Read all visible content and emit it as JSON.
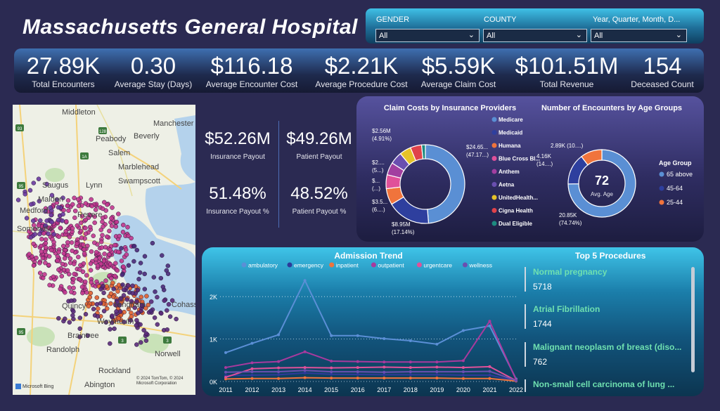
{
  "header": {
    "title": "Massachusetts General Hospital"
  },
  "filters": [
    {
      "label": "GENDER",
      "value": "All"
    },
    {
      "label": "COUNTY",
      "value": "All"
    },
    {
      "label": "Year, Quarter, Month, D...",
      "value": "All"
    }
  ],
  "kpis": [
    {
      "value": "27.89K",
      "label": "Total Encounters"
    },
    {
      "value": "0.30",
      "label": "Average Stay (Days)"
    },
    {
      "value": "$116.18",
      "label": "Average Encounter Cost"
    },
    {
      "value": "$2.21K",
      "label": "Average Procedure Cost"
    },
    {
      "value": "$5.59K",
      "label": "Average Claim Cost"
    },
    {
      "value": "$101.51M",
      "label": "Total Revenue"
    },
    {
      "value": "154",
      "label": "Deceased Count"
    }
  ],
  "map": {
    "places": [
      "Middleton",
      "Manchester",
      "Peabody",
      "Beverly",
      "Salem",
      "Marblehead",
      "Swampscott",
      "Saugus",
      "Lynn",
      "Malden",
      "Medford",
      "Revere",
      "Somerville",
      "Quincy",
      "Hingham",
      "Cohasset",
      "Weymouth",
      "Braintree",
      "Randolph",
      "Norwell",
      "Rockland",
      "Abington"
    ],
    "highway_shields": [
      "93",
      "95",
      "128",
      "1A",
      "3",
      "95",
      "3"
    ],
    "attribution": "© 2024 TomTom, © 2024 Microsoft Corporation",
    "logo": "Microsoft Bing"
  },
  "payout": {
    "insurance_payout": {
      "value": "$52.26M",
      "label": "Insurance Payout"
    },
    "patient_payout": {
      "value": "$49.26M",
      "label": "Patient Payout"
    },
    "insurance_pct": {
      "value": "51.48%",
      "label": "Insurance Payout %"
    },
    "patient_pct": {
      "value": "48.52%",
      "label": "Patient Payout %"
    }
  },
  "chart_data": [
    {
      "type": "pie",
      "title": "Claim Costs by Insurance Providers",
      "legend_position": "right",
      "categories": [
        "Medicare",
        "Medicaid",
        "Humana",
        "Blue Cross Bl...",
        "Anthem",
        "Aetna",
        "UnitedHealth...",
        "Cigna Health",
        "Dual Eligible"
      ],
      "values": [
        47.17,
        17.14,
        6.5,
        5.5,
        5.0,
        4.91,
        4.6,
        4.5,
        1.5
      ],
      "colors": [
        "#5a8fd4",
        "#2e3f9e",
        "#f0743c",
        "#e0519a",
        "#a23fa0",
        "#6a4fb0",
        "#e6c229",
        "#e0424a",
        "#1d8a80"
      ],
      "data_labels": [
        {
          "slice": "Medicare",
          "line1": "$24.65...",
          "line2": "(47.17...)"
        },
        {
          "slice": "Medicaid",
          "line1": "$8.95M",
          "line2": "(17.14%)"
        },
        {
          "slice": "Humana",
          "line1": "$3.5...",
          "line2": "(6....)"
        },
        {
          "slice": "Blue Cross Bl...",
          "line1": "$...",
          "line2": "(...)"
        },
        {
          "slice": "Anthem",
          "line1": "$2....",
          "line2": "(5...)"
        },
        {
          "slice": "Aetna",
          "line1": "$2.56M",
          "line2": "(4.91%)"
        }
      ]
    },
    {
      "type": "pie",
      "title": "Number of Encounters by Age Groups",
      "legend_title": "Age Group",
      "legend_position": "right",
      "categories": [
        "65 above",
        "45-64",
        "25-44"
      ],
      "values": [
        20.85,
        4.16,
        2.89
      ],
      "percent": [
        74.74,
        14.9,
        10.4
      ],
      "colors": [
        "#5a8fd4",
        "#2e3f9e",
        "#f0743c"
      ],
      "center_value": "72",
      "center_label": "Avg. Age",
      "data_labels": [
        {
          "slice": "65 above",
          "line1": "20.85K",
          "line2": "(74.74%)"
        },
        {
          "slice": "45-64",
          "line1": "4.16K",
          "line2": "(14....)"
        },
        {
          "slice": "25-44",
          "line1": "2.89K (10....)",
          "line2": ""
        }
      ]
    },
    {
      "type": "line",
      "title": "Admission Trend",
      "legend_position": "top",
      "x": [
        2011,
        2012,
        2013,
        2014,
        2015,
        2016,
        2017,
        2018,
        2019,
        2020,
        2021,
        2022
      ],
      "ylim": [
        0,
        2500
      ],
      "yticks": [
        0,
        1000,
        2000
      ],
      "ytick_labels": [
        "0K",
        "1K",
        "2K"
      ],
      "grid": true,
      "series": [
        {
          "name": "ambulatory",
          "color": "#5b8fd6",
          "values": [
            680,
            900,
            1100,
            2380,
            1080,
            1080,
            1010,
            960,
            880,
            1200,
            1310,
            60
          ]
        },
        {
          "name": "emergency",
          "color": "#2d3a9a",
          "values": [
            140,
            150,
            160,
            200,
            170,
            165,
            160,
            160,
            160,
            150,
            150,
            10
          ]
        },
        {
          "name": "inpatient",
          "color": "#f0743c",
          "values": [
            60,
            70,
            70,
            90,
            80,
            80,
            80,
            80,
            80,
            70,
            70,
            10
          ]
        },
        {
          "name": "outpatient",
          "color": "#a83a9e",
          "values": [
            330,
            440,
            470,
            700,
            480,
            470,
            460,
            460,
            460,
            490,
            1420,
            40
          ]
        },
        {
          "name": "urgentcare",
          "color": "#e0519a",
          "values": [
            100,
            300,
            320,
            330,
            320,
            330,
            340,
            330,
            340,
            330,
            350,
            20
          ]
        },
        {
          "name": "wellness",
          "color": "#6a4fb0",
          "values": [
            220,
            230,
            230,
            260,
            230,
            230,
            220,
            230,
            230,
            230,
            240,
            20
          ]
        }
      ]
    }
  ],
  "procedures": {
    "title": "Top 5 Procedures",
    "items": [
      {
        "name": "Normal pregnancy",
        "count": "5718"
      },
      {
        "name": "Atrial Fibrillation",
        "count": "1744"
      },
      {
        "name": "Malignant neoplasm of breast (diso...",
        "count": "762"
      },
      {
        "name": "Non-small cell carcinoma of lung ...",
        "count": ""
      }
    ]
  }
}
